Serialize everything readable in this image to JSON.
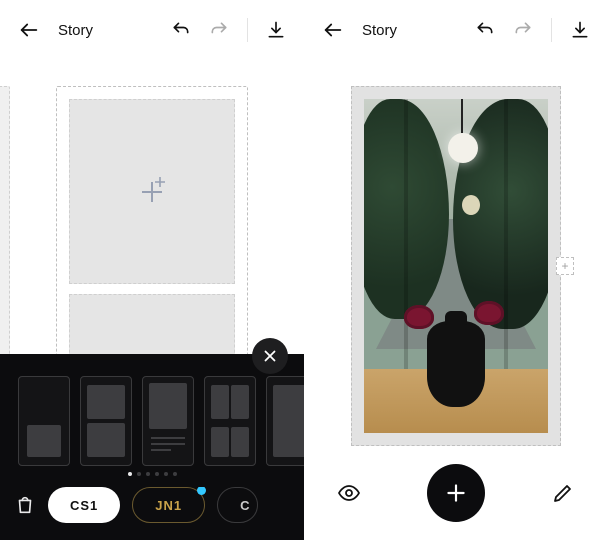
{
  "left": {
    "title": "Story",
    "drawer": {
      "packs": [
        {
          "label": "CS1",
          "selected": true
        },
        {
          "label": "JN1",
          "selected": false,
          "badge": true
        },
        {
          "label": "C",
          "selected": false,
          "truncated": true
        }
      ],
      "page_count": 6,
      "active_page": 0
    }
  },
  "right": {
    "title": "Story"
  },
  "icons": {
    "back": "arrow-left",
    "undo": "undo",
    "redo": "redo",
    "download": "download",
    "close": "x",
    "shop": "shopping-bag",
    "eye": "eye",
    "add": "plus",
    "edit": "pencil",
    "add_small": "+"
  }
}
